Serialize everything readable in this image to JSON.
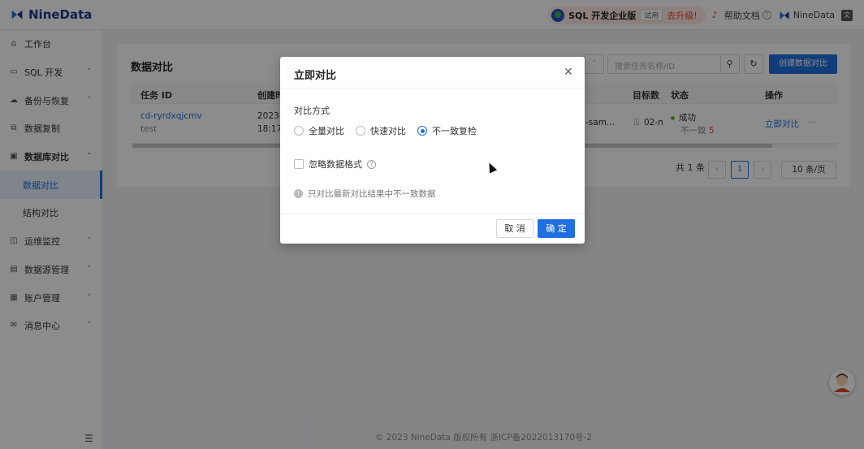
{
  "header": {
    "logo": "NineData",
    "promo_title": "SQL 开发企业版",
    "trial_badge": "试用",
    "upgrade": "去升级!",
    "help_docs": "帮助文档",
    "user": "NineData"
  },
  "sidebar": {
    "items": [
      {
        "label": "工作台",
        "icon": "home-icon"
      },
      {
        "label": "SQL 开发",
        "icon": "console-icon",
        "chevron": "˅"
      },
      {
        "label": "备份与恢复",
        "icon": "cloud-icon",
        "chevron": "˅"
      },
      {
        "label": "数据复制",
        "icon": "copy-icon"
      },
      {
        "label": "数据库对比",
        "icon": "compare-icon",
        "chevron": "˄"
      },
      {
        "label": "数据对比",
        "sub": true,
        "active": true
      },
      {
        "label": "结构对比",
        "sub": true
      },
      {
        "label": "运维监控",
        "icon": "monitor-icon",
        "chevron": "˅"
      },
      {
        "label": "数据源管理",
        "icon": "datasource-icon",
        "chevron": "˅"
      },
      {
        "label": "账户管理",
        "icon": "account-icon",
        "chevron": "˅"
      },
      {
        "label": "消息中心",
        "icon": "mail-icon",
        "chevron": "˅"
      }
    ]
  },
  "main": {
    "title": "数据对比",
    "search_placeholder": "搜索任务名称/ID",
    "create_button": "创建数据对比",
    "columns": [
      "任务 ID",
      "创建时",
      "目标数",
      "状态",
      "操作"
    ],
    "row": {
      "task_id": "cd-ryrdxqjcmv",
      "task_name": "test",
      "created_date": "2023-",
      "created_time": "18:17",
      "source_partial": "-sam...",
      "target_partial": "02-n",
      "status": "成功",
      "inconsistent_label": "不一致",
      "inconsistent_count": "5",
      "action": "立即对比",
      "more": "···"
    },
    "pagination": {
      "total": "共 1 条",
      "current_page": "1",
      "page_size": "10 条/页"
    }
  },
  "footer": "© 2023 NineData 版权所有  浙ICP备2022013170号-2",
  "modal": {
    "title": "立即对比",
    "method_label": "对比方式",
    "options": [
      {
        "label": "全量对比",
        "selected": false
      },
      {
        "label": "快速对比",
        "selected": false
      },
      {
        "label": "不一致复检",
        "selected": true
      }
    ],
    "ignore_format": "忽略数据格式",
    "info": "只对比最新对比结果中不一致数据",
    "cancel": "取 消",
    "ok": "确 定"
  },
  "colors": {
    "primary": "#1f6fe0",
    "success": "#52c41a",
    "danger": "#e0462e"
  }
}
